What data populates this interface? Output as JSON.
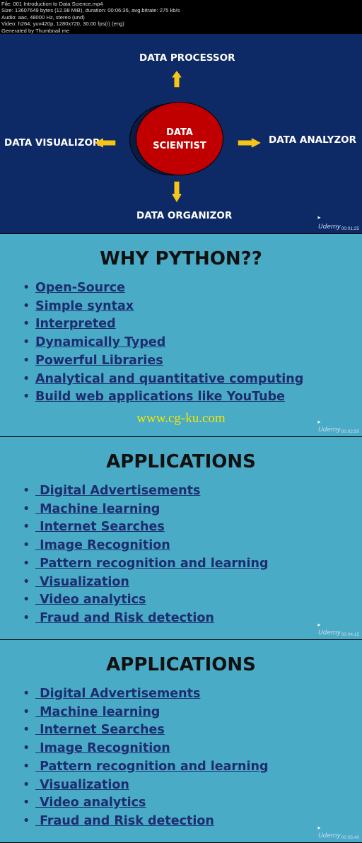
{
  "meta": {
    "lines": [
      "File: 001 Introduction to Data Science.mp4",
      "Size: 13607649 bytes (12.98 MiB), duration: 00:06:36, avg.bitrate: 275 kb/s",
      "Audio: aac, 48000 Hz, stereo (und)",
      "Video: h264, yuv420p, 1280x720, 30.00 fps(r) (eng)",
      "Generated by Thumbnail me"
    ]
  },
  "frames": [
    {
      "center": [
        "DATA",
        "SCIENTIST"
      ],
      "top": "DATA PROCESSOR",
      "left": "DATA VISUALIZOR",
      "right": "DATA ANALYZOR",
      "bottom": "DATA ORGANIZOR",
      "logo": "Udemy",
      "timestamp": "00:01:25",
      "colors": {
        "bg": "#0e2a66",
        "circle": "#c00000",
        "arrow": "#f5c518"
      }
    },
    {
      "title": "WHY PYTHON??",
      "items": [
        "Open-Source",
        "Simple syntax",
        "Interpreted",
        "Dynamically Typed",
        "Powerful Libraries",
        "Analytical and quantitative computing",
        "Build web applications like YouTube"
      ],
      "watermark": "www.cg-ku.com",
      "logo": "Udemy",
      "timestamp": "00:02:50"
    },
    {
      "title": "APPLICATIONS",
      "items": [
        " Digital Advertisements",
        " Machine learning",
        " Internet Searches",
        " Image Recognition",
        " Pattern recognition and learning",
        " Visualization",
        " Video analytics",
        " Fraud and Risk detection"
      ],
      "logo": "Udemy",
      "timestamp": "00:04:15"
    },
    {
      "title": "APPLICATIONS",
      "items": [
        " Digital Advertisements",
        " Machine learning",
        " Internet Searches",
        " Image Recognition",
        " Pattern recognition and learning",
        " Visualization",
        " Video analytics",
        " Fraud and Risk detection"
      ],
      "logo": "Udemy",
      "timestamp": "00:05:40"
    }
  ],
  "bullet": "•"
}
